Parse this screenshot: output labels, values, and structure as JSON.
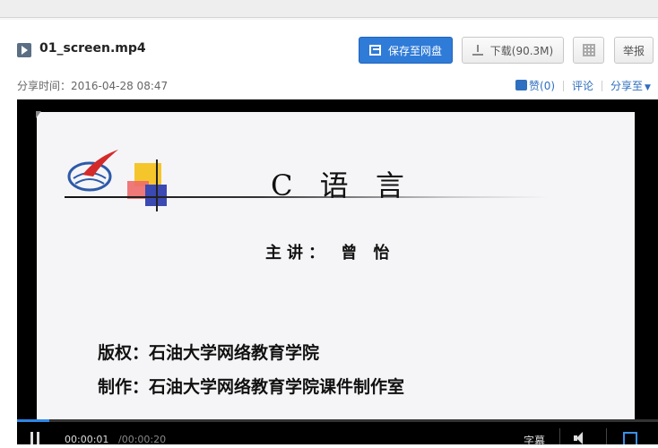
{
  "file": {
    "name": "01_screen.mp4",
    "share_time": "分享时间：2016-04-28 08:47"
  },
  "toolbar": {
    "save_label": "保存至网盘",
    "download_label": "下载(90.3M)",
    "report_label": "举报"
  },
  "actions": {
    "like_label": "赞",
    "like_count": "(0)",
    "comment_label": "评论",
    "share_label": "分享至"
  },
  "slide": {
    "title": "C 语 言",
    "lecturer": "主讲： 曾 怡",
    "copyright": "版权：石油大学网络教育学院",
    "producer": "制作：石油大学网络教育学院课件制作室"
  },
  "player": {
    "current_time": "00:00:01",
    "total_time": "/00:00:20",
    "subtitle_label": "字幕",
    "progress": 0.05
  },
  "colors": {
    "accent": "#2f7bd8",
    "link": "#2f6fbf"
  }
}
